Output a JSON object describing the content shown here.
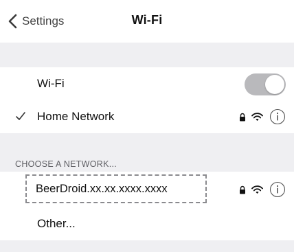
{
  "navbar": {
    "back_label": "Settings",
    "title": "Wi-Fi"
  },
  "wifi_toggle": {
    "label": "Wi-Fi",
    "state": "on"
  },
  "connected_network": {
    "name": "Home Network",
    "checked": true,
    "secured": true,
    "icons": [
      "checkmark-icon",
      "lock-icon",
      "wifi-signal-icon",
      "info-icon"
    ]
  },
  "section": {
    "header": "CHOOSE A NETWORK..."
  },
  "networks": [
    {
      "name": "BeerDroid.xx.xx.xxxx.xxxx",
      "secured": true,
      "highlighted": true,
      "icons": [
        "lock-icon",
        "wifi-signal-icon",
        "info-icon"
      ]
    }
  ],
  "other": {
    "label": "Other..."
  },
  "colors": {
    "background": "#ffffff",
    "group_background": "#efeff2",
    "toggle_on": "#b9b9bc",
    "separator": "#d4d4d8",
    "dashed_border": "#8a8a8e"
  }
}
